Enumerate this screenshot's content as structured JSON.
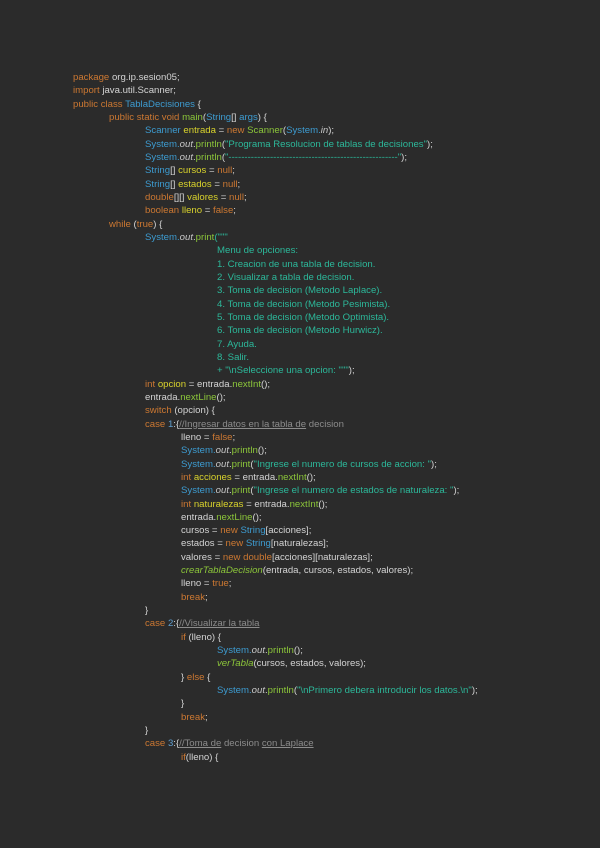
{
  "colors": {
    "background": "#2b2b2b",
    "keyword": "#cc7832",
    "type": "#3d9bd0",
    "variable": "#d8d22c",
    "string": "#2cb89a",
    "method": "#8cc63a",
    "comment": "#8c8c8c"
  },
  "lines": [
    {
      "tabs": 0,
      "tokens": [
        [
          "package ",
          "kw"
        ],
        [
          "org.ip.sesion05;",
          "plain"
        ]
      ]
    },
    {
      "tabs": 0,
      "tokens": [
        [
          "import ",
          "kw"
        ],
        [
          "java.util.Scanner;",
          "plain"
        ]
      ]
    },
    {
      "tabs": 0,
      "tokens": [
        [
          "public class ",
          "kw"
        ],
        [
          "TablaDecisiones",
          "type"
        ],
        [
          " {",
          "plain"
        ]
      ]
    },
    {
      "tabs": 1,
      "tokens": [
        [
          "public static void ",
          "kw"
        ],
        [
          "main",
          "method"
        ],
        [
          "(",
          "plain"
        ],
        [
          "String",
          "type"
        ],
        [
          "[] ",
          "plain"
        ],
        [
          "args",
          "type"
        ],
        [
          ") {",
          "plain"
        ]
      ]
    },
    {
      "tabs": 2,
      "tokens": [
        [
          "Scanner ",
          "type"
        ],
        [
          "entrada",
          "var"
        ],
        [
          " = ",
          "plain"
        ],
        [
          "new ",
          "kw"
        ],
        [
          "Scanner",
          "method"
        ],
        [
          "(",
          "plain"
        ],
        [
          "System.",
          "type"
        ],
        [
          "in",
          "field"
        ],
        [
          ");",
          "plain"
        ]
      ]
    },
    {
      "tabs": 2,
      "tokens": [
        [
          "System.",
          "type"
        ],
        [
          "out",
          "field"
        ],
        [
          ".",
          "plain"
        ],
        [
          "println",
          "method"
        ],
        [
          "(",
          "plain"
        ],
        [
          "\"Programa Resolucion de tablas de decisiones\"",
          "str"
        ],
        [
          ");",
          "plain"
        ]
      ]
    },
    {
      "tabs": 2,
      "tokens": [
        [
          "System.",
          "type"
        ],
        [
          "out",
          "field"
        ],
        [
          ".",
          "plain"
        ],
        [
          "println",
          "method"
        ],
        [
          "(",
          "plain"
        ],
        [
          "\"-----------------------------------------------------\"",
          "str"
        ],
        [
          ");",
          "plain"
        ]
      ]
    },
    {
      "tabs": 2,
      "tokens": [
        [
          "String",
          "type"
        ],
        [
          "[] ",
          "plain"
        ],
        [
          "cursos",
          "var"
        ],
        [
          " = ",
          "plain"
        ],
        [
          "null",
          "kw"
        ],
        [
          ";",
          "plain"
        ]
      ]
    },
    {
      "tabs": 2,
      "tokens": [
        [
          "String",
          "type"
        ],
        [
          "[] ",
          "plain"
        ],
        [
          "estados",
          "var"
        ],
        [
          " = ",
          "plain"
        ],
        [
          "null",
          "kw"
        ],
        [
          ";",
          "plain"
        ]
      ]
    },
    {
      "tabs": 2,
      "tokens": [
        [
          "double",
          "kw"
        ],
        [
          "[][] ",
          "plain"
        ],
        [
          "valores",
          "var"
        ],
        [
          " = ",
          "plain"
        ],
        [
          "null",
          "kw"
        ],
        [
          ";",
          "plain"
        ]
      ]
    },
    {
      "tabs": 2,
      "tokens": [
        [
          "boolean ",
          "kw"
        ],
        [
          "lleno",
          "var"
        ],
        [
          " = ",
          "plain"
        ],
        [
          "false",
          "kw"
        ],
        [
          ";",
          "plain"
        ]
      ]
    },
    {
      "tabs": 1,
      "tokens": [
        [
          "while ",
          "kw"
        ],
        [
          "(",
          "plain"
        ],
        [
          "true",
          "kw"
        ],
        [
          ") {",
          "plain"
        ]
      ]
    },
    {
      "tabs": 2,
      "tokens": [
        [
          "System.",
          "type"
        ],
        [
          "out",
          "field"
        ],
        [
          ".",
          "plain"
        ],
        [
          "print",
          "method"
        ],
        [
          "(\"\"\"",
          "str"
        ]
      ]
    },
    {
      "tabs": 4,
      "tokens": [
        [
          "Menu de opciones:",
          "str"
        ]
      ]
    },
    {
      "tabs": 4,
      "tokens": [
        [
          "1. Creacion de una tabla de decision.",
          "str"
        ]
      ]
    },
    {
      "tabs": 4,
      "tokens": [
        [
          "2. Visualizar a tabla de decision.",
          "str"
        ]
      ]
    },
    {
      "tabs": 4,
      "tokens": [
        [
          "3. Toma de decision (Metodo Laplace).",
          "str"
        ]
      ]
    },
    {
      "tabs": 4,
      "tokens": [
        [
          "4. Toma de decision (Metodo Pesimista).",
          "str"
        ]
      ]
    },
    {
      "tabs": 4,
      "tokens": [
        [
          "5. Toma de decision (Metodo Optimista).",
          "str"
        ]
      ]
    },
    {
      "tabs": 4,
      "tokens": [
        [
          "6. Toma de decision (Metodo Hurwicz).",
          "str"
        ]
      ]
    },
    {
      "tabs": 4,
      "tokens": [
        [
          "7. Ayuda.",
          "str"
        ]
      ]
    },
    {
      "tabs": 4,
      "tokens": [
        [
          "8. Salir.",
          "str"
        ]
      ]
    },
    {
      "tabs": 4,
      "tokens": [
        [
          "+ \"\\nSeleccione una opcion: \"\"\"",
          "str"
        ],
        [
          ");",
          "plain"
        ]
      ]
    },
    {
      "tabs": 2,
      "tokens": [
        [
          "int ",
          "kw"
        ],
        [
          "opcion",
          "var"
        ],
        [
          " = entrada.",
          "plain"
        ],
        [
          "nextInt",
          "method"
        ],
        [
          "();",
          "plain"
        ]
      ]
    },
    {
      "tabs": 2,
      "tokens": [
        [
          "entrada.",
          "plain"
        ],
        [
          "nextLine",
          "method"
        ],
        [
          "();",
          "plain"
        ]
      ]
    },
    {
      "tabs": 2,
      "tokens": [
        [
          "switch ",
          "kw"
        ],
        [
          "(opcion) {",
          "plain"
        ]
      ]
    },
    {
      "tabs": 2,
      "tokens": [
        [
          "case ",
          "kw"
        ],
        [
          "1",
          "num"
        ],
        [
          ":{",
          "plain"
        ],
        [
          "//Ingresar datos en la tabla de",
          "comment"
        ],
        [
          " decision",
          "comment2"
        ]
      ]
    },
    {
      "tabs": 3,
      "tokens": [
        [
          "lleno = ",
          "plain"
        ],
        [
          "false",
          "kw"
        ],
        [
          ";",
          "plain"
        ]
      ]
    },
    {
      "tabs": 3,
      "tokens": [
        [
          "System.",
          "type"
        ],
        [
          "out",
          "field"
        ],
        [
          ".",
          "plain"
        ],
        [
          "println",
          "method"
        ],
        [
          "();",
          "plain"
        ]
      ]
    },
    {
      "tabs": 3,
      "tokens": [
        [
          "System.",
          "type"
        ],
        [
          "out",
          "field"
        ],
        [
          ".",
          "plain"
        ],
        [
          "print",
          "method"
        ],
        [
          "(",
          "plain"
        ],
        [
          "\"Ingrese el numero de cursos de accion: \"",
          "str"
        ],
        [
          ");",
          "plain"
        ]
      ]
    },
    {
      "tabs": 3,
      "tokens": [
        [
          "int ",
          "kw"
        ],
        [
          "acciones",
          "var"
        ],
        [
          " = entrada.",
          "plain"
        ],
        [
          "nextInt",
          "method"
        ],
        [
          "();",
          "plain"
        ]
      ]
    },
    {
      "tabs": 3,
      "tokens": [
        [
          "System.",
          "type"
        ],
        [
          "out",
          "field"
        ],
        [
          ".",
          "plain"
        ],
        [
          "print",
          "method"
        ],
        [
          "(",
          "plain"
        ],
        [
          "\"Ingrese el numero de estados de naturaleza: \"",
          "str"
        ],
        [
          ");",
          "plain"
        ]
      ]
    },
    {
      "tabs": 3,
      "tokens": [
        [
          "int ",
          "kw"
        ],
        [
          "naturalezas",
          "var"
        ],
        [
          " = entrada.",
          "plain"
        ],
        [
          "nextInt",
          "method"
        ],
        [
          "();",
          "plain"
        ]
      ]
    },
    {
      "tabs": 3,
      "tokens": [
        [
          "entrada.",
          "plain"
        ],
        [
          "nextLine",
          "method"
        ],
        [
          "();",
          "plain"
        ]
      ]
    },
    {
      "tabs": 3,
      "tokens": [
        [
          "cursos = ",
          "plain"
        ],
        [
          "new ",
          "kw"
        ],
        [
          "String",
          "type"
        ],
        [
          "[acciones];",
          "plain"
        ]
      ]
    },
    {
      "tabs": 3,
      "tokens": [
        [
          "estados = ",
          "plain"
        ],
        [
          "new ",
          "kw"
        ],
        [
          "String",
          "type"
        ],
        [
          "[naturalezas];",
          "plain"
        ]
      ]
    },
    {
      "tabs": 3,
      "tokens": [
        [
          "valores = ",
          "plain"
        ],
        [
          "new ",
          "kw"
        ],
        [
          "double",
          "kw"
        ],
        [
          "[acciones][naturalezas];",
          "plain"
        ]
      ]
    },
    {
      "tabs": 3,
      "tokens": [
        [
          "crearTablaDecision",
          "imethod"
        ],
        [
          "(entrada, cursos, estados, valores);",
          "plain"
        ]
      ]
    },
    {
      "tabs": 3,
      "tokens": [
        [
          "lleno = ",
          "plain"
        ],
        [
          "true",
          "kw"
        ],
        [
          ";",
          "plain"
        ]
      ]
    },
    {
      "tabs": 3,
      "tokens": [
        [
          "break",
          "kw"
        ],
        [
          ";",
          "plain"
        ]
      ]
    },
    {
      "tabs": 2,
      "tokens": [
        [
          "}",
          "plain"
        ]
      ]
    },
    {
      "tabs": 2,
      "tokens": [
        [
          "case ",
          "kw"
        ],
        [
          "2",
          "num"
        ],
        [
          ":{",
          "plain"
        ],
        [
          "//Visualizar la tabla",
          "comment"
        ]
      ]
    },
    {
      "tabs": 3,
      "tokens": [
        [
          "if ",
          "kw"
        ],
        [
          "(lleno) {",
          "plain"
        ]
      ]
    },
    {
      "tabs": 4,
      "tokens": [
        [
          "System.",
          "type"
        ],
        [
          "out",
          "field"
        ],
        [
          ".",
          "plain"
        ],
        [
          "println",
          "method"
        ],
        [
          "();",
          "plain"
        ]
      ]
    },
    {
      "tabs": 4,
      "tokens": [
        [
          "verTabla",
          "imethod"
        ],
        [
          "(cursos, estados, valores);",
          "plain"
        ]
      ]
    },
    {
      "tabs": 3,
      "tokens": [
        [
          "} ",
          "plain"
        ],
        [
          "else ",
          "kw"
        ],
        [
          "{",
          "plain"
        ]
      ]
    },
    {
      "tabs": 4,
      "tokens": [
        [
          "System.",
          "type"
        ],
        [
          "out",
          "field"
        ],
        [
          ".",
          "plain"
        ],
        [
          "println",
          "method"
        ],
        [
          "(",
          "plain"
        ],
        [
          "\"\\nPrimero debera introducir los datos.\\n\"",
          "str"
        ],
        [
          ");",
          "plain"
        ]
      ]
    },
    {
      "tabs": 3,
      "tokens": [
        [
          "}",
          "plain"
        ]
      ]
    },
    {
      "tabs": 3,
      "tokens": [
        [
          "break",
          "kw"
        ],
        [
          ";",
          "plain"
        ]
      ]
    },
    {
      "tabs": 2,
      "tokens": [
        [
          "}",
          "plain"
        ]
      ]
    },
    {
      "tabs": 2,
      "tokens": [
        [
          "case ",
          "kw"
        ],
        [
          "3",
          "num"
        ],
        [
          ":{",
          "plain"
        ],
        [
          "//Toma de",
          "comment"
        ],
        [
          " decision ",
          "comment2"
        ],
        [
          "con Laplace",
          "comment"
        ]
      ]
    },
    {
      "tabs": 3,
      "tokens": [
        [
          "if",
          "kw"
        ],
        [
          "(lleno) {",
          "plain"
        ]
      ]
    }
  ]
}
